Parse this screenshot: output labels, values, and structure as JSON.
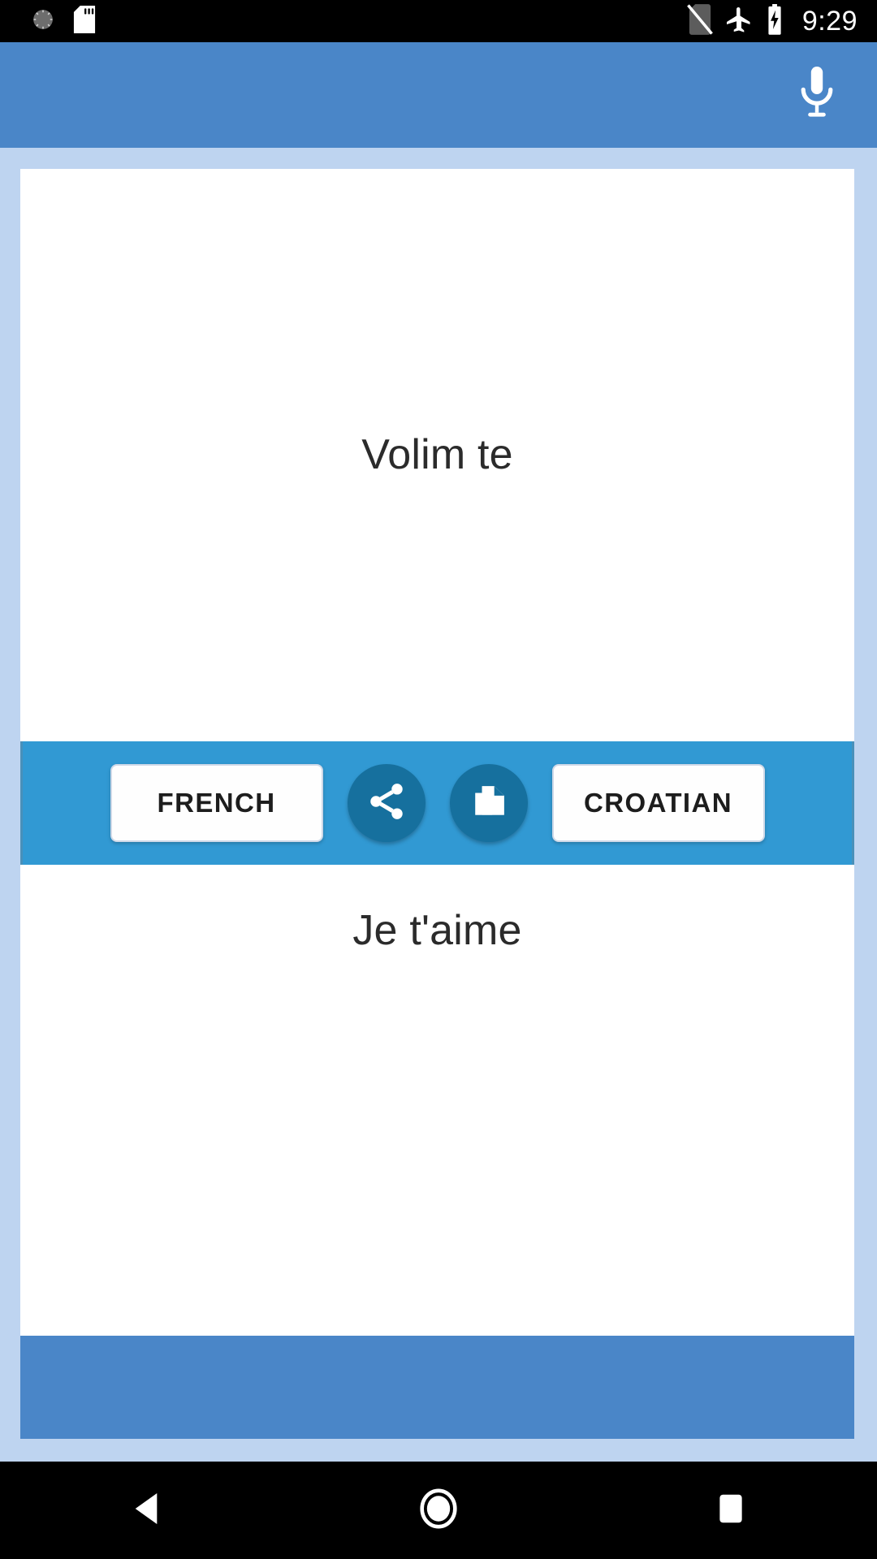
{
  "status_bar": {
    "time": "9:29",
    "left_icons": [
      {
        "name": "alarm-icon",
        "label": "alarm"
      },
      {
        "name": "sd-card-icon",
        "label": "sd card"
      }
    ],
    "right_icons": [
      {
        "name": "no-sim-icon",
        "label": "no sim"
      },
      {
        "name": "airplane-mode-icon",
        "label": "airplane mode"
      },
      {
        "name": "battery-charging-icon",
        "label": "battery charging"
      }
    ],
    "background_color": "#000000",
    "foreground_color": "#ffffff"
  },
  "app_bar": {
    "title": "",
    "background_color": "#4a86c8",
    "mic_icon": "microphone-icon"
  },
  "translator": {
    "source": {
      "text": "Volim te",
      "language_label": "CROATIAN"
    },
    "target": {
      "text": "Je t'aime",
      "language_label": "FRENCH"
    },
    "controls": {
      "left_language_label": "FRENCH",
      "right_language_label": "CROATIAN",
      "share_icon": "share-icon",
      "copy_icon": "copy-icon",
      "bar_color": "#3199d3",
      "circle_color": "#16709e"
    }
  },
  "background": {
    "page_color": "#bed4f0",
    "card_color": "#ffffff",
    "footer_color": "#4a86c8"
  },
  "nav_bar": {
    "back_label": "Back",
    "home_label": "Home",
    "recents_label": "Recents",
    "background_color": "#000000"
  }
}
